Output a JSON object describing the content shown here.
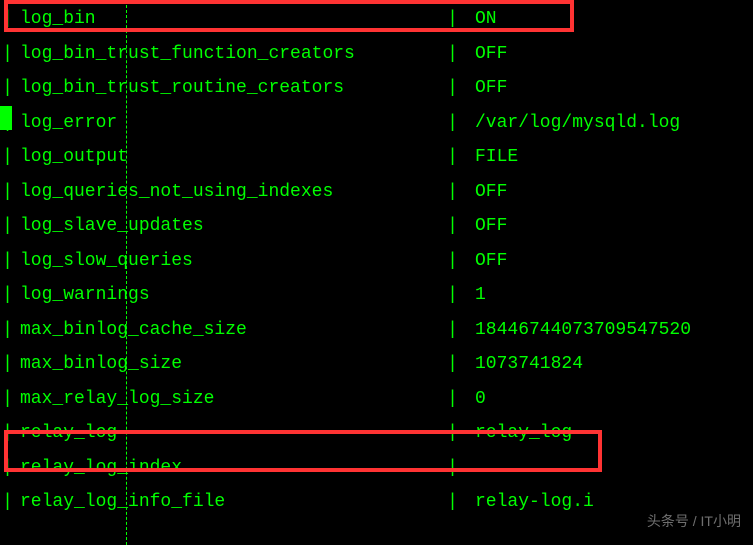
{
  "pipe": "|",
  "rows": [
    {
      "name": "log_bin",
      "value": "ON"
    },
    {
      "name": "log_bin_trust_function_creators",
      "value": "OFF"
    },
    {
      "name": "log_bin_trust_routine_creators",
      "value": "OFF"
    },
    {
      "name": "log_error",
      "value": "/var/log/mysqld.log"
    },
    {
      "name": "log_output",
      "value": "FILE"
    },
    {
      "name": "log_queries_not_using_indexes",
      "value": "OFF"
    },
    {
      "name": "log_slave_updates",
      "value": "OFF"
    },
    {
      "name": "log_slow_queries",
      "value": "OFF"
    },
    {
      "name": "log_warnings",
      "value": "1"
    },
    {
      "name": "max_binlog_cache_size",
      "value": "18446744073709547520"
    },
    {
      "name": "max_binlog_size",
      "value": "1073741824"
    },
    {
      "name": "max_relay_log_size",
      "value": "0"
    },
    {
      "name": "relay_log",
      "value": "relay_log"
    },
    {
      "name": "relay_log_index",
      "value": ""
    },
    {
      "name": "relay_log_info_file",
      "value": "relay-log.i"
    }
  ],
  "watermark": "头条号 / IT小明"
}
